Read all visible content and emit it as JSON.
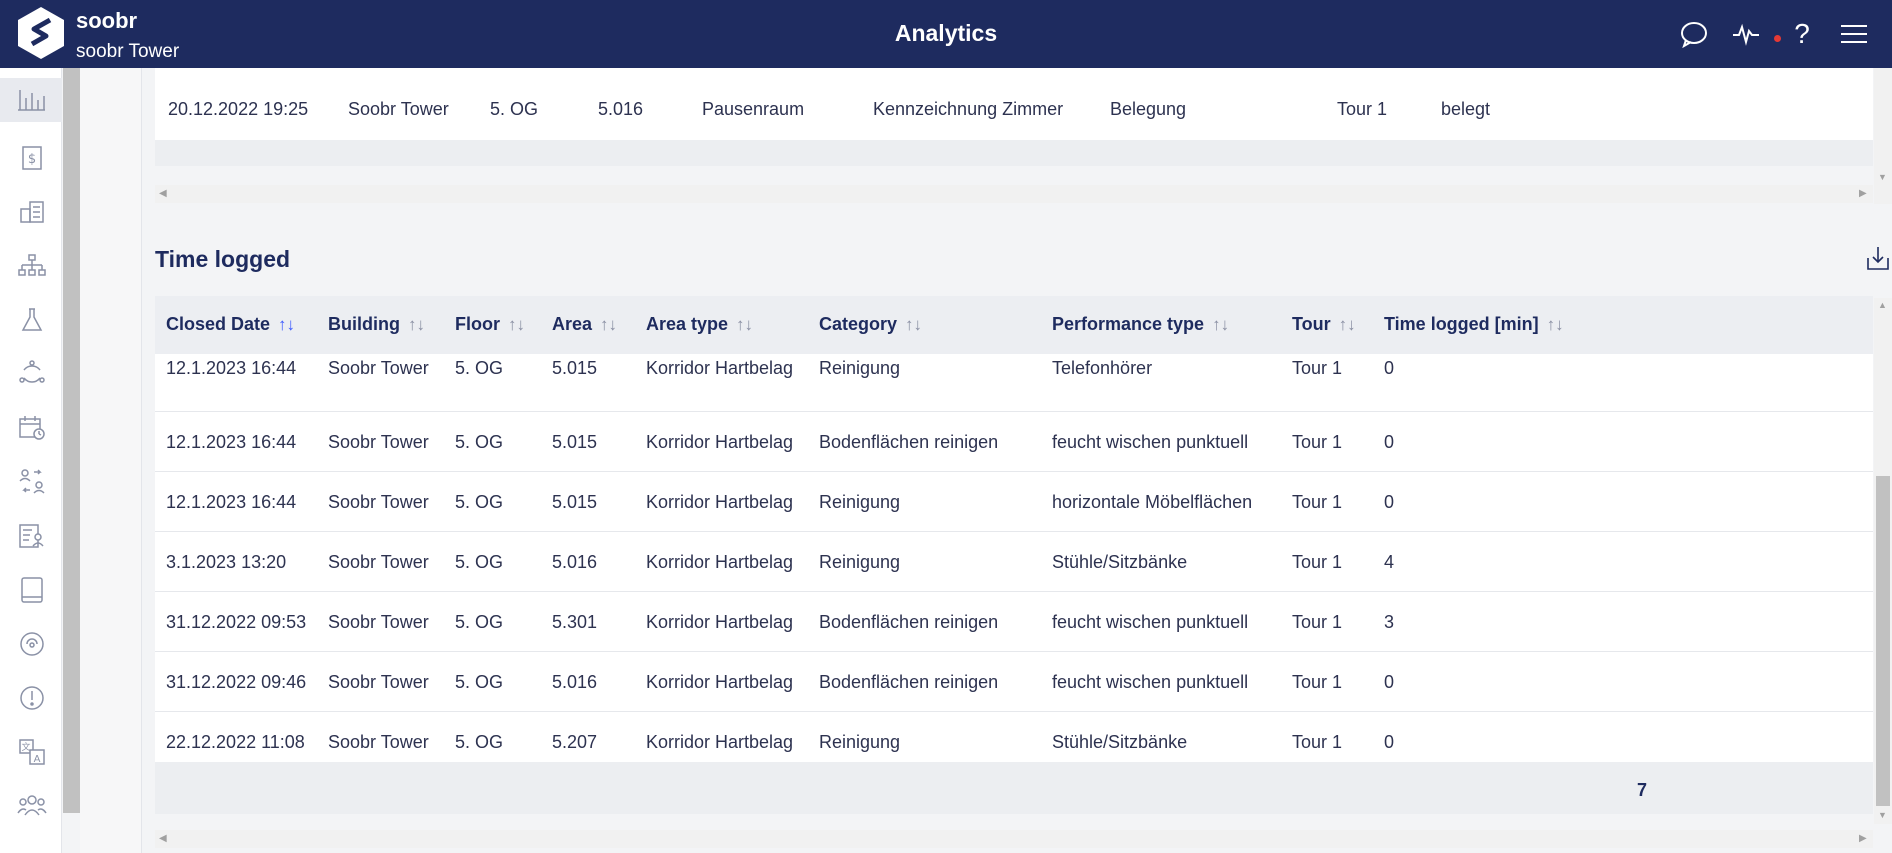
{
  "header": {
    "brand": "soobr",
    "building": "soobr Tower",
    "title": "Analytics",
    "icons": [
      "chat-icon",
      "activity-icon",
      "help-icon",
      "menu-icon"
    ],
    "help_glyph": "?",
    "accent_color": "#1e2b5f",
    "notification_color": "#e53935"
  },
  "sidebar": {
    "items": [
      {
        "icon": "analytics-icon",
        "active": true
      },
      {
        "icon": "billing-icon"
      },
      {
        "icon": "buildings-icon"
      },
      {
        "icon": "hierarchy-icon"
      },
      {
        "icon": "lab-flask-icon"
      },
      {
        "icon": "cycle-icon"
      },
      {
        "icon": "schedule-icon"
      },
      {
        "icon": "user-swap-icon"
      },
      {
        "icon": "user-document-icon"
      },
      {
        "icon": "tablet-icon"
      },
      {
        "icon": "sensor-icon"
      },
      {
        "icon": "alert-icon"
      },
      {
        "icon": "translate-icon"
      },
      {
        "icon": "team-icon"
      }
    ]
  },
  "previous_table": {
    "row": [
      "20.12.2022 19:25",
      "Soobr Tower",
      "5. OG",
      "5.016",
      "Pausenraum",
      "Kennzeichnung Zimmer",
      "Belegung",
      "Tour 1",
      "belegt"
    ]
  },
  "time_logged": {
    "title": "Time logged",
    "columns": [
      "Closed Date",
      "Building",
      "Floor",
      "Area",
      "Area type",
      "Category",
      "Performance type",
      "Tour",
      "Time logged [min]"
    ],
    "sort_glyph": "↑↓",
    "rows": [
      [
        "12.1.2023 16:44",
        "Soobr Tower",
        "5. OG",
        "5.015",
        "Korridor Hartbelag",
        "Reinigung",
        "Telefonhörer",
        "Tour 1",
        "0"
      ],
      [
        "12.1.2023 16:44",
        "Soobr Tower",
        "5. OG",
        "5.015",
        "Korridor Hartbelag",
        "Bodenflächen reinigen",
        "feucht wischen punktuell",
        "Tour 1",
        "0"
      ],
      [
        "12.1.2023 16:44",
        "Soobr Tower",
        "5. OG",
        "5.015",
        "Korridor Hartbelag",
        "Reinigung",
        "horizontale Möbelflächen",
        "Tour 1",
        "0"
      ],
      [
        "3.1.2023 13:20",
        "Soobr Tower",
        "5. OG",
        "5.016",
        "Korridor Hartbelag",
        "Reinigung",
        "Stühle/Sitzbänke",
        "Tour 1",
        "4"
      ],
      [
        "31.12.2022 09:53",
        "Soobr Tower",
        "5. OG",
        "5.301",
        "Korridor Hartbelag",
        "Bodenflächen reinigen",
        "feucht wischen punktuell",
        "Tour 1",
        "3"
      ],
      [
        "31.12.2022 09:46",
        "Soobr Tower",
        "5. OG",
        "5.016",
        "Korridor Hartbelag",
        "Bodenflächen reinigen",
        "feucht wischen punktuell",
        "Tour 1",
        "0"
      ],
      [
        "22.12.2022 11:08",
        "Soobr Tower",
        "5. OG",
        "5.207",
        "Korridor Hartbelag",
        "Reinigung",
        "Stühle/Sitzbänke",
        "Tour 1",
        "0"
      ]
    ],
    "total": "7"
  }
}
